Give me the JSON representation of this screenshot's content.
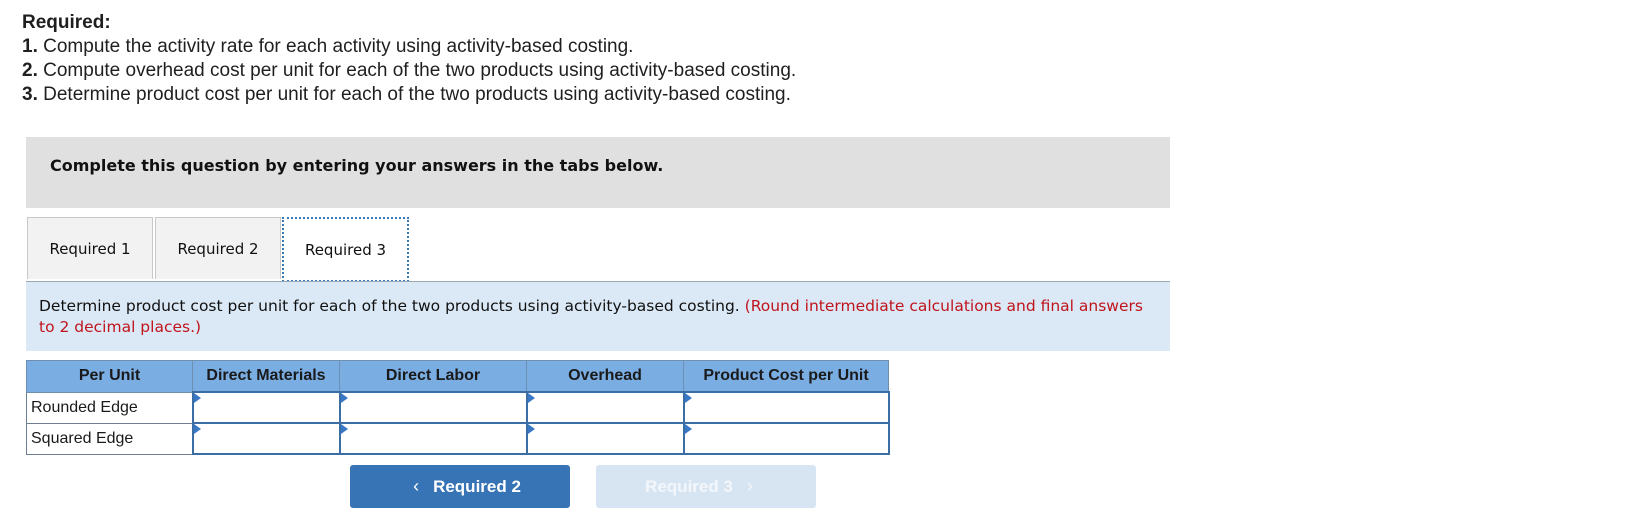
{
  "required": {
    "title": "Required:",
    "items": [
      {
        "num": "1.",
        "text": " Compute the activity rate for each activity using activity-based costing."
      },
      {
        "num": "2.",
        "text": " Compute overhead cost per unit for each of the two products using activity-based costing."
      },
      {
        "num": "3.",
        "text": " Determine product cost per unit for each of the two products using activity-based costing."
      }
    ]
  },
  "instruction": "Complete this question by entering your answers in the tabs below.",
  "tabs": [
    {
      "label": "Required 1",
      "active": false
    },
    {
      "label": "Required 2",
      "active": false
    },
    {
      "label": "Required 3",
      "active": true
    }
  ],
  "prompt": {
    "text": "Determine product cost per unit for each of the two products using activity-based costing. ",
    "note": "(Round intermediate calculations and final answers to 2 decimal places.)"
  },
  "table": {
    "headers": [
      "Per Unit",
      "Direct Materials",
      "Direct Labor",
      "Overhead",
      "Product Cost per Unit"
    ],
    "rows": [
      {
        "label": "Rounded Edge",
        "values": [
          "",
          "",
          "",
          ""
        ]
      },
      {
        "label": "Squared Edge",
        "values": [
          "",
          "",
          "",
          ""
        ]
      }
    ]
  },
  "nav": {
    "prev_label": "Required 2",
    "prev_icon": "chevron-left-icon",
    "next_label": "Required 3",
    "next_icon": "chevron-right-icon",
    "next_disabled": true
  },
  "colors": {
    "header_blue": "#7aaee3",
    "button_blue": "#3674b5",
    "note_red": "#c0141c",
    "prompt_bg": "#dbe9f6"
  }
}
